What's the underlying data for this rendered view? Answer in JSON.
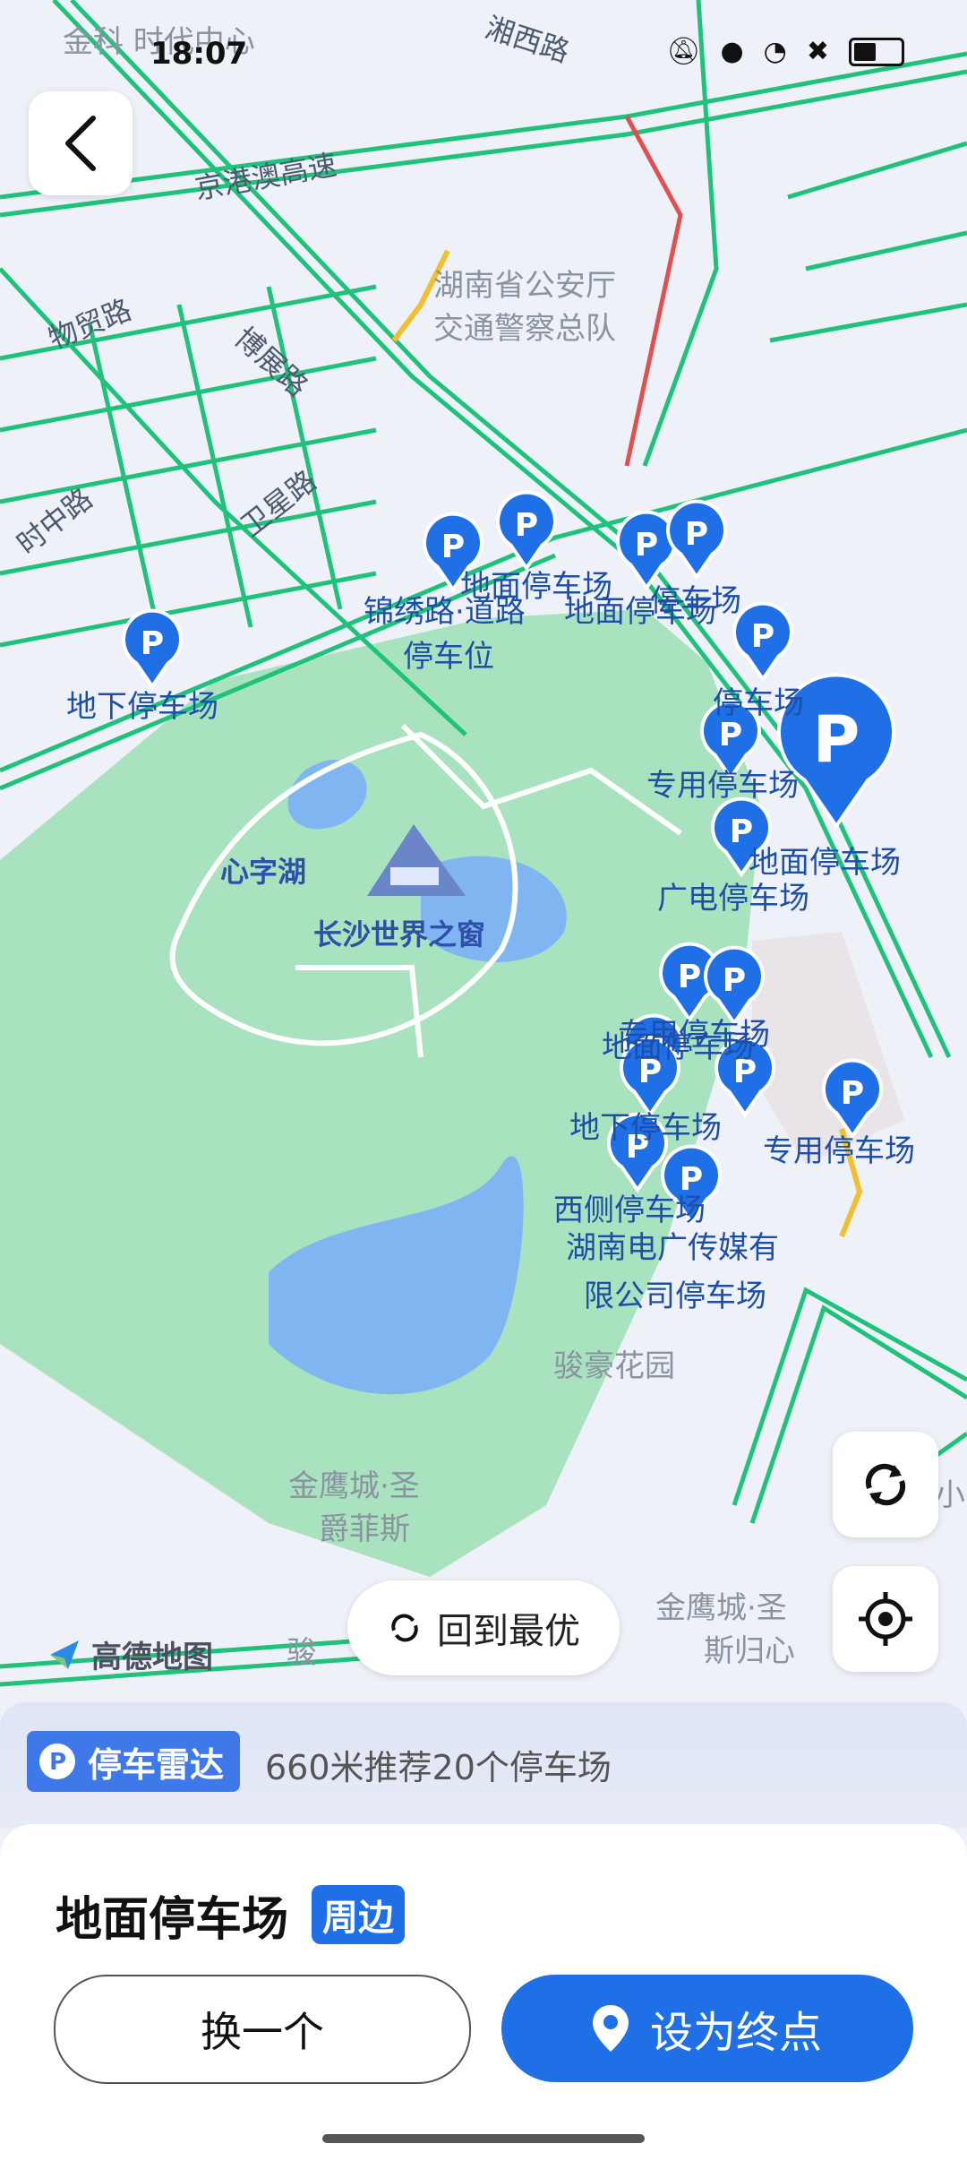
{
  "status": {
    "time": "18:07"
  },
  "map": {
    "roads": [
      "京港澳高速",
      "物贸路",
      "博展路",
      "卫星路",
      "时中路"
    ],
    "places": [
      {
        "id": "jinke",
        "text": "金科 时代中心"
      },
      {
        "id": "police",
        "text": "湖南省公安厅"
      },
      {
        "id": "police2",
        "text": "交通警察总队"
      },
      {
        "id": "xinzihu",
        "text": "心字湖"
      },
      {
        "id": "window",
        "text": "长沙世界之窗"
      },
      {
        "id": "junhao",
        "text": "骏豪花园"
      },
      {
        "id": "jinying1",
        "text": "金鹰城·圣"
      },
      {
        "id": "jinying2",
        "text": "爵菲斯"
      },
      {
        "id": "jinying3",
        "text": "金鹰城·圣"
      },
      {
        "id": "jinying4",
        "text": "斯归心"
      },
      {
        "id": "junhao2",
        "text": "骏"
      },
      {
        "id": "xiao",
        "text": "小"
      },
      {
        "id": "hunanroad",
        "text": "湘西路"
      }
    ],
    "parking_labels": [
      {
        "id": "p1",
        "text": "地面停车场"
      },
      {
        "id": "p2",
        "text": "锦绣路·道路"
      },
      {
        "id": "p3",
        "text": "停车位"
      },
      {
        "id": "p4",
        "text": "地面停车场"
      },
      {
        "id": "p5",
        "text": "停车场"
      },
      {
        "id": "p6",
        "text": "地下停车场"
      },
      {
        "id": "p7",
        "text": "停车场"
      },
      {
        "id": "p8",
        "text": "专用停车场"
      },
      {
        "id": "p9",
        "text": "地面停车场"
      },
      {
        "id": "p10",
        "text": "广电停车场"
      },
      {
        "id": "p11",
        "text": "专用停车场"
      },
      {
        "id": "p12",
        "text": "地面停车场"
      },
      {
        "id": "p13",
        "text": "地下停车场"
      },
      {
        "id": "p14",
        "text": "专用停车场"
      },
      {
        "id": "p15",
        "text": "西侧停车场"
      },
      {
        "id": "p16",
        "text": "湖南电广传媒有"
      },
      {
        "id": "p17",
        "text": "限公司停车场"
      }
    ],
    "pin_letter": "P",
    "logo": "高德地图",
    "back_to_best": "回到最优"
  },
  "radar": {
    "badge": "停车雷达",
    "summary": "660米推荐20个停车场"
  },
  "sheet": {
    "title": "地面停车场",
    "badge": "周边",
    "change_button": "换一个",
    "destination_button": "设为终点"
  },
  "colors": {
    "accent": "#1f6fe6",
    "road": "#1ec27a",
    "park": "#a8e0bc",
    "water": "#7fb6f2"
  }
}
